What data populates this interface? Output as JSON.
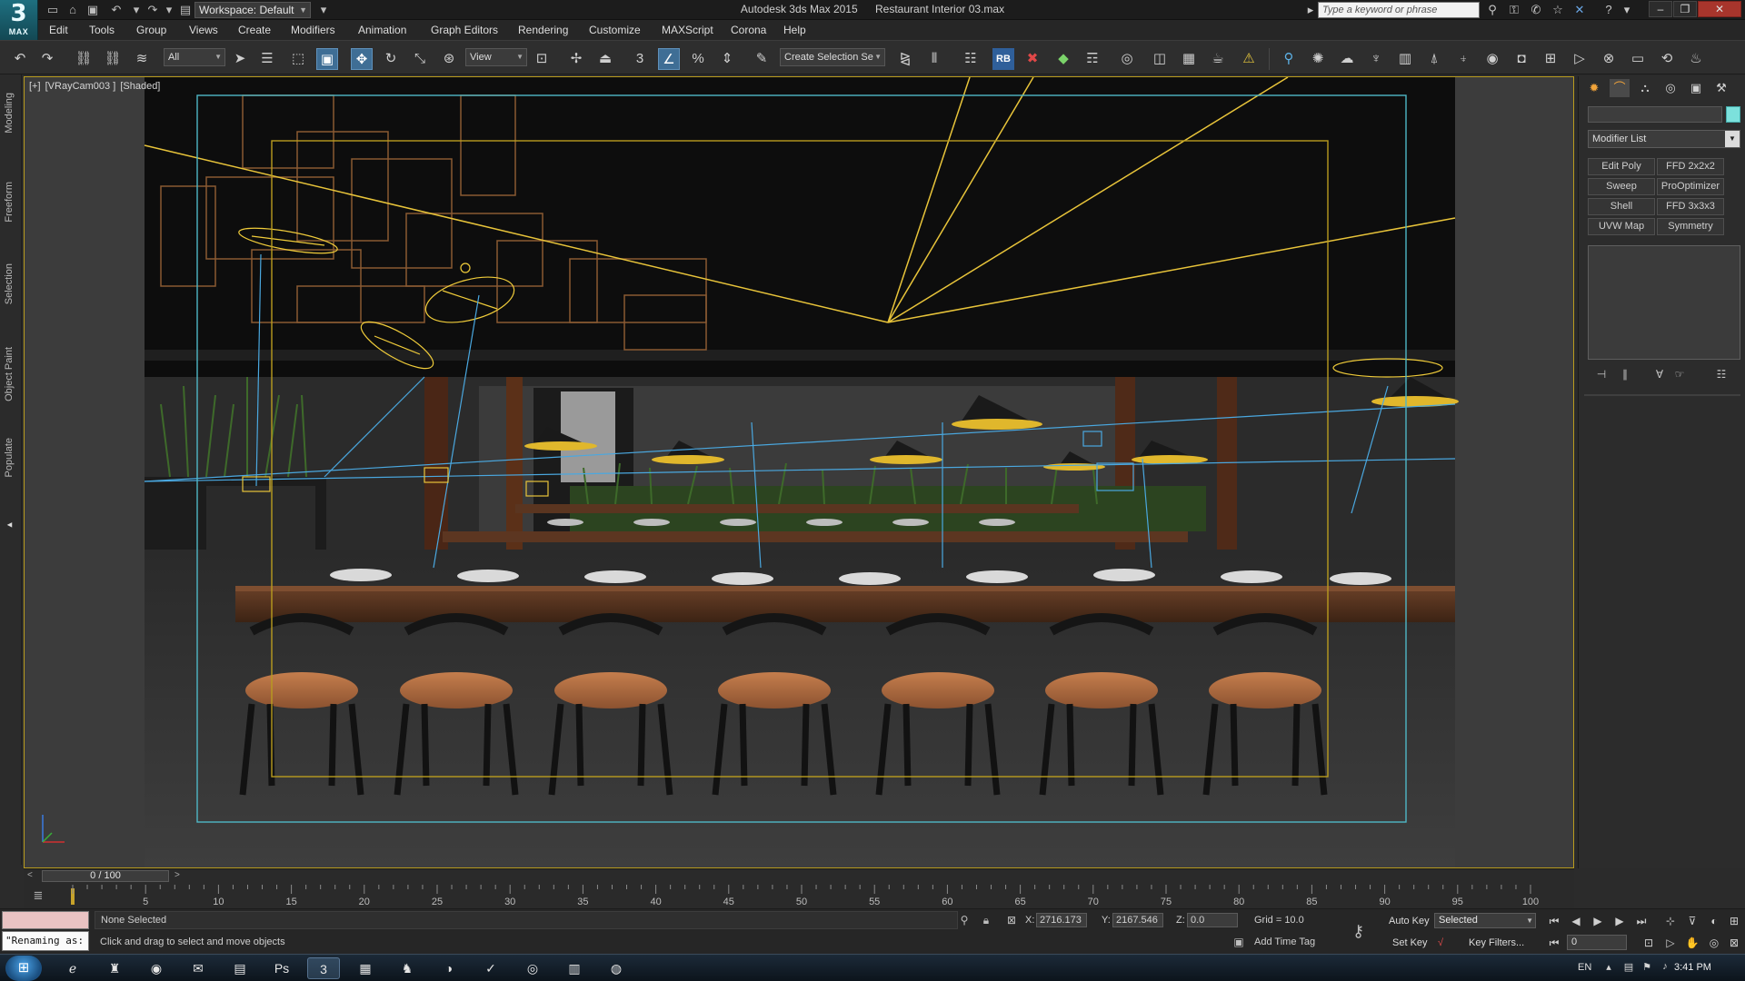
{
  "app": {
    "logo_text": "MAX",
    "workspace": "Workspace: Default",
    "title": "Autodesk 3ds Max 2015",
    "filename": "Restaurant Interior 03.max",
    "search_placeholder": "Type a keyword or phrase"
  },
  "menu": [
    "Edit",
    "Tools",
    "Group",
    "Views",
    "Create",
    "Modifiers",
    "Animation",
    "Graph Editors",
    "Rendering",
    "Customize",
    "MAXScript",
    "Corona",
    "Help"
  ],
  "toolbar": {
    "selection_filter": "All",
    "reference_coord": "View",
    "named_selection": "Create Selection Se",
    "snap_3": "3",
    "percent_snap": "%",
    "rb_label": "RB"
  },
  "ribbon_tabs": [
    "Modeling",
    "Freeform",
    "Selection",
    "Object Paint",
    "Populate"
  ],
  "viewport": {
    "label_plus": "[+]",
    "label_camera": "[VRayCam003 ]",
    "label_shading": "[Shaded]"
  },
  "command_panel": {
    "modifier_list": "Modifier List",
    "modifier_buttons": [
      "Edit Poly",
      "FFD 2x2x2",
      "Sweep",
      "ProOptimizer",
      "Shell",
      "FFD 3x3x3",
      "UVW Map",
      "Symmetry"
    ]
  },
  "timeline": {
    "frame_display": "0 / 100",
    "ticks": [
      "5",
      "10",
      "15",
      "20",
      "25",
      "30",
      "35",
      "40",
      "45",
      "50",
      "55",
      "60",
      "65",
      "70",
      "75",
      "80",
      "85",
      "90",
      "95",
      "100"
    ]
  },
  "status": {
    "maxscript_output": "\"Renaming as:",
    "selection": "None Selected",
    "prompt": "Click and drag to select and move objects",
    "x_label": "X:",
    "x_value": "2716.173",
    "y_label": "Y:",
    "y_value": "2167.546",
    "z_label": "Z:",
    "z_value": "0.0",
    "grid": "Grid = 10.0",
    "add_time_tag": "Add Time Tag",
    "auto_key": "Auto Key",
    "set_key": "Set Key",
    "key_filters": "Key Filters...",
    "key_mode": "Selected",
    "current_frame": "0"
  },
  "taskbar": {
    "language": "EN",
    "clock": "3:41 PM"
  },
  "colors": {
    "frame_border": "#b99c1f",
    "safe_frame": "#4fb7c6",
    "light_wire": "#f0cc3a",
    "accent": "#3f6e95"
  }
}
